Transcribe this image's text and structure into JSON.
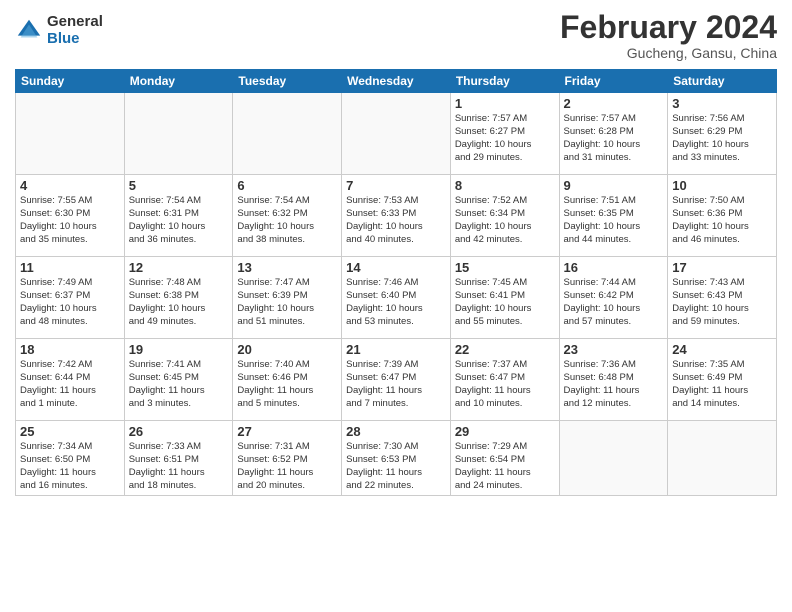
{
  "header": {
    "logo_general": "General",
    "logo_blue": "Blue",
    "month": "February 2024",
    "location": "Gucheng, Gansu, China"
  },
  "days_of_week": [
    "Sunday",
    "Monday",
    "Tuesday",
    "Wednesday",
    "Thursday",
    "Friday",
    "Saturday"
  ],
  "weeks": [
    [
      {
        "day": "",
        "info": ""
      },
      {
        "day": "",
        "info": ""
      },
      {
        "day": "",
        "info": ""
      },
      {
        "day": "",
        "info": ""
      },
      {
        "day": "1",
        "info": "Sunrise: 7:57 AM\nSunset: 6:27 PM\nDaylight: 10 hours\nand 29 minutes."
      },
      {
        "day": "2",
        "info": "Sunrise: 7:57 AM\nSunset: 6:28 PM\nDaylight: 10 hours\nand 31 minutes."
      },
      {
        "day": "3",
        "info": "Sunrise: 7:56 AM\nSunset: 6:29 PM\nDaylight: 10 hours\nand 33 minutes."
      }
    ],
    [
      {
        "day": "4",
        "info": "Sunrise: 7:55 AM\nSunset: 6:30 PM\nDaylight: 10 hours\nand 35 minutes."
      },
      {
        "day": "5",
        "info": "Sunrise: 7:54 AM\nSunset: 6:31 PM\nDaylight: 10 hours\nand 36 minutes."
      },
      {
        "day": "6",
        "info": "Sunrise: 7:54 AM\nSunset: 6:32 PM\nDaylight: 10 hours\nand 38 minutes."
      },
      {
        "day": "7",
        "info": "Sunrise: 7:53 AM\nSunset: 6:33 PM\nDaylight: 10 hours\nand 40 minutes."
      },
      {
        "day": "8",
        "info": "Sunrise: 7:52 AM\nSunset: 6:34 PM\nDaylight: 10 hours\nand 42 minutes."
      },
      {
        "day": "9",
        "info": "Sunrise: 7:51 AM\nSunset: 6:35 PM\nDaylight: 10 hours\nand 44 minutes."
      },
      {
        "day": "10",
        "info": "Sunrise: 7:50 AM\nSunset: 6:36 PM\nDaylight: 10 hours\nand 46 minutes."
      }
    ],
    [
      {
        "day": "11",
        "info": "Sunrise: 7:49 AM\nSunset: 6:37 PM\nDaylight: 10 hours\nand 48 minutes."
      },
      {
        "day": "12",
        "info": "Sunrise: 7:48 AM\nSunset: 6:38 PM\nDaylight: 10 hours\nand 49 minutes."
      },
      {
        "day": "13",
        "info": "Sunrise: 7:47 AM\nSunset: 6:39 PM\nDaylight: 10 hours\nand 51 minutes."
      },
      {
        "day": "14",
        "info": "Sunrise: 7:46 AM\nSunset: 6:40 PM\nDaylight: 10 hours\nand 53 minutes."
      },
      {
        "day": "15",
        "info": "Sunrise: 7:45 AM\nSunset: 6:41 PM\nDaylight: 10 hours\nand 55 minutes."
      },
      {
        "day": "16",
        "info": "Sunrise: 7:44 AM\nSunset: 6:42 PM\nDaylight: 10 hours\nand 57 minutes."
      },
      {
        "day": "17",
        "info": "Sunrise: 7:43 AM\nSunset: 6:43 PM\nDaylight: 10 hours\nand 59 minutes."
      }
    ],
    [
      {
        "day": "18",
        "info": "Sunrise: 7:42 AM\nSunset: 6:44 PM\nDaylight: 11 hours\nand 1 minute."
      },
      {
        "day": "19",
        "info": "Sunrise: 7:41 AM\nSunset: 6:45 PM\nDaylight: 11 hours\nand 3 minutes."
      },
      {
        "day": "20",
        "info": "Sunrise: 7:40 AM\nSunset: 6:46 PM\nDaylight: 11 hours\nand 5 minutes."
      },
      {
        "day": "21",
        "info": "Sunrise: 7:39 AM\nSunset: 6:47 PM\nDaylight: 11 hours\nand 7 minutes."
      },
      {
        "day": "22",
        "info": "Sunrise: 7:37 AM\nSunset: 6:47 PM\nDaylight: 11 hours\nand 10 minutes."
      },
      {
        "day": "23",
        "info": "Sunrise: 7:36 AM\nSunset: 6:48 PM\nDaylight: 11 hours\nand 12 minutes."
      },
      {
        "day": "24",
        "info": "Sunrise: 7:35 AM\nSunset: 6:49 PM\nDaylight: 11 hours\nand 14 minutes."
      }
    ],
    [
      {
        "day": "25",
        "info": "Sunrise: 7:34 AM\nSunset: 6:50 PM\nDaylight: 11 hours\nand 16 minutes."
      },
      {
        "day": "26",
        "info": "Sunrise: 7:33 AM\nSunset: 6:51 PM\nDaylight: 11 hours\nand 18 minutes."
      },
      {
        "day": "27",
        "info": "Sunrise: 7:31 AM\nSunset: 6:52 PM\nDaylight: 11 hours\nand 20 minutes."
      },
      {
        "day": "28",
        "info": "Sunrise: 7:30 AM\nSunset: 6:53 PM\nDaylight: 11 hours\nand 22 minutes."
      },
      {
        "day": "29",
        "info": "Sunrise: 7:29 AM\nSunset: 6:54 PM\nDaylight: 11 hours\nand 24 minutes."
      },
      {
        "day": "",
        "info": ""
      },
      {
        "day": "",
        "info": ""
      }
    ]
  ]
}
